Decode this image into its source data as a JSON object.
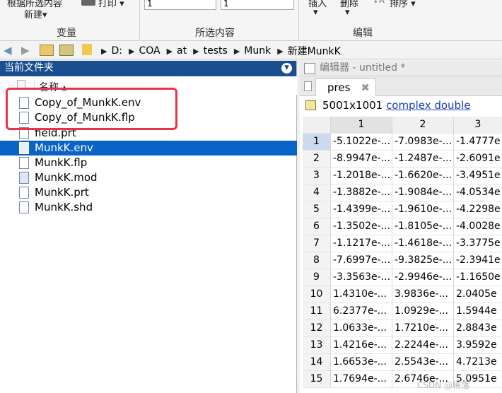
{
  "ribbon": {
    "cut_top_text_1": "根据所选内容",
    "new_label": "新建▾",
    "print_label": "打印 ▾",
    "input_1": "1",
    "input_2": "1",
    "insert_label": "插入",
    "delete_label": "删除",
    "sort_label": "排序 ▾",
    "group_variable": "变量",
    "group_selection": "所选内容",
    "group_edit": "编辑"
  },
  "address_bar": {
    "crumbs": [
      "D:",
      "COA",
      "at",
      "tests",
      "Munk",
      "新建MunkK"
    ]
  },
  "current_folder": {
    "title": "当前文件夹",
    "column_name": "名称 ▴",
    "files": [
      {
        "name": "Copy_of_MunkK.env",
        "type": "doc",
        "selected": false
      },
      {
        "name": "Copy_of_MunkK.flp",
        "type": "doc",
        "selected": false
      },
      {
        "name": "field.prt",
        "type": "doc",
        "selected": false
      },
      {
        "name": "MunkK.env",
        "type": "doc",
        "selected": true
      },
      {
        "name": "MunkK.flp",
        "type": "doc",
        "selected": false
      },
      {
        "name": "MunkK.mod",
        "type": "mod",
        "selected": false
      },
      {
        "name": "MunkK.prt",
        "type": "doc",
        "selected": false
      },
      {
        "name": "MunkK.shd",
        "type": "doc",
        "selected": false
      }
    ]
  },
  "editor": {
    "title": "编辑器 - untitled *",
    "tab": "pres",
    "size_text": "5001x1001",
    "type_link": "complex double",
    "col_headers": [
      "1",
      "2",
      "3"
    ],
    "rows": [
      {
        "n": "1",
        "v": [
          "-5.1022e-...",
          "-7.0983e-...",
          "-1.4777e"
        ]
      },
      {
        "n": "2",
        "v": [
          "-8.9947e-...",
          "-1.2487e-...",
          "-2.6091e"
        ]
      },
      {
        "n": "3",
        "v": [
          "-1.2018e-...",
          "-1.6620e-...",
          "-3.4951e"
        ]
      },
      {
        "n": "4",
        "v": [
          "-1.3882e-...",
          "-1.9084e-...",
          "-4.0534e"
        ]
      },
      {
        "n": "5",
        "v": [
          "-1.4399e-...",
          "-1.9610e-...",
          "-4.2298e"
        ]
      },
      {
        "n": "6",
        "v": [
          "-1.3502e-...",
          "-1.8105e-...",
          "-4.0028e"
        ]
      },
      {
        "n": "7",
        "v": [
          "-1.1217e-...",
          "-1.4618e-...",
          "-3.3775e"
        ]
      },
      {
        "n": "8",
        "v": [
          "-7.6997e-...",
          "-9.3825e-...",
          "-2.3941e"
        ]
      },
      {
        "n": "9",
        "v": [
          "-3.3563e-...",
          "-2.9946e-...",
          "-1.1650e"
        ]
      },
      {
        "n": "10",
        "v": [
          "1.4310e-...",
          "3.9836e-...",
          "2.0405e"
        ]
      },
      {
        "n": "11",
        "v": [
          "6.2377e-...",
          "1.0929e-...",
          "1.5944e"
        ]
      },
      {
        "n": "12",
        "v": [
          "1.0633e-...",
          "1.7210e-...",
          "2.8843e"
        ]
      },
      {
        "n": "13",
        "v": [
          "1.4216e-...",
          "2.2244e-...",
          "3.9592e"
        ]
      },
      {
        "n": "14",
        "v": [
          "1.6653e-...",
          "2.5543e-...",
          "4.7213e"
        ]
      },
      {
        "n": "15",
        "v": [
          "1.7694e-...",
          "2.6746e-...",
          "5.0951e"
        ]
      }
    ]
  },
  "watermark": "CSDN @稀落"
}
